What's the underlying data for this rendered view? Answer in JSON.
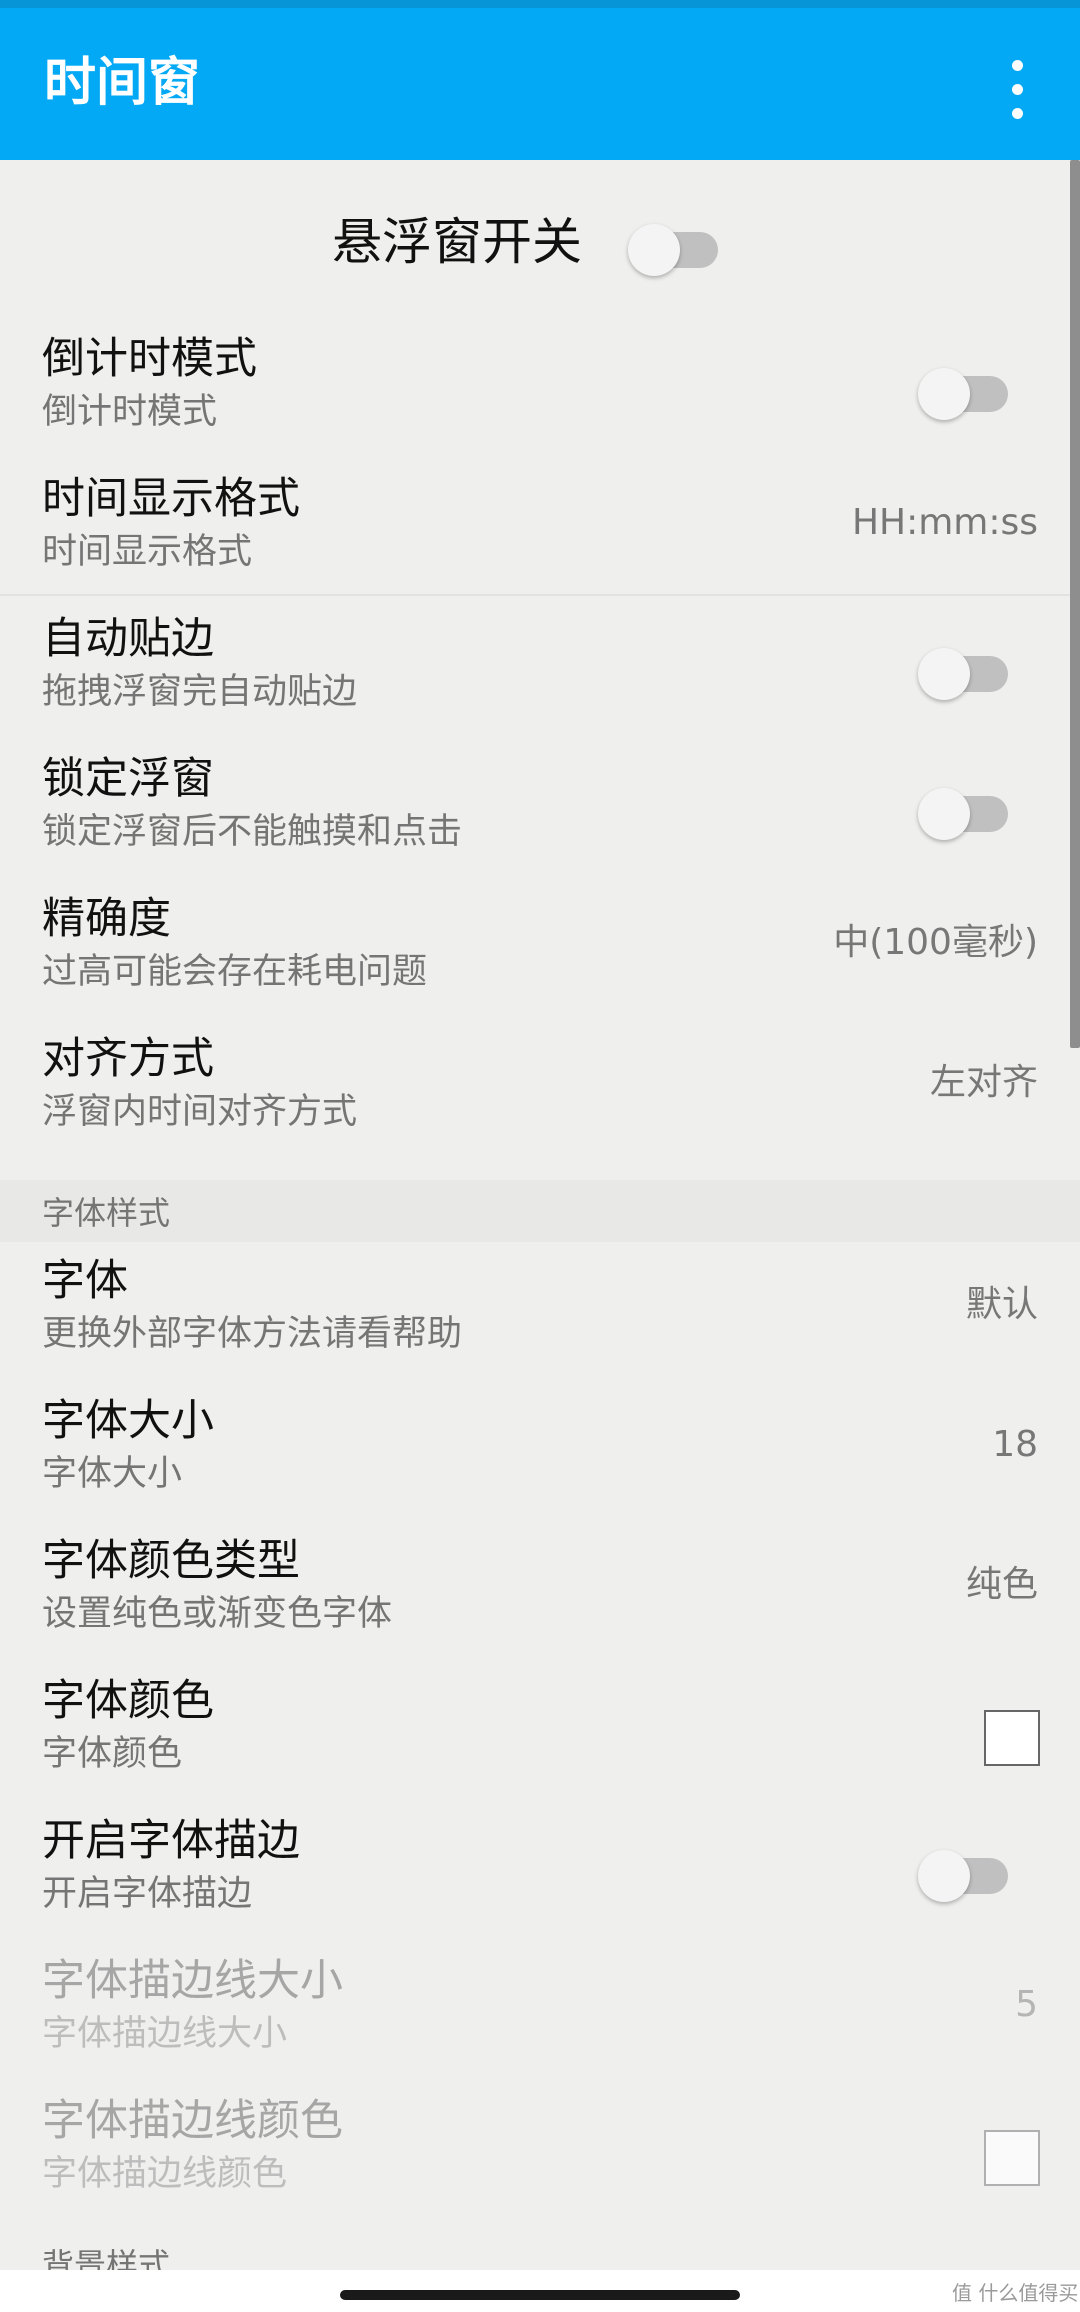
{
  "app": {
    "title": "时间窗"
  },
  "master_switch": {
    "label": "悬浮窗开关",
    "state": "off"
  },
  "prefs": [
    {
      "title": "倒计时模式",
      "summary": "倒计时模式",
      "widget": "switch",
      "state": "off"
    },
    {
      "title": "时间显示格式",
      "summary": "时间显示格式",
      "value": "HH:mm:ss"
    },
    {
      "title": "自动贴边",
      "summary": "拖拽浮窗完自动贴边",
      "widget": "switch",
      "state": "off"
    },
    {
      "title": "锁定浮窗",
      "summary": "锁定浮窗后不能触摸和点击",
      "widget": "switch",
      "state": "off"
    },
    {
      "title": "精确度",
      "summary": "过高可能会存在耗电问题",
      "value": "中(100毫秒)"
    },
    {
      "title": "对齐方式",
      "summary": "浮窗内时间对齐方式",
      "value": "左对齐"
    }
  ],
  "font_category": {
    "label": "字体样式"
  },
  "font_prefs": [
    {
      "title": "字体",
      "summary": "更换外部字体方法请看帮助",
      "value": "默认"
    },
    {
      "title": "字体大小",
      "summary": "字体大小",
      "value": "18"
    },
    {
      "title": "字体颜色类型",
      "summary": "设置纯色或渐变色字体",
      "value": "纯色"
    },
    {
      "title": "字体颜色",
      "summary": "字体颜色",
      "widget": "color",
      "color": "#ffffff"
    },
    {
      "title": "开启字体描边",
      "summary": "开启字体描边",
      "widget": "switch",
      "state": "off"
    },
    {
      "title": "字体描边线大小",
      "summary": "字体描边线大小",
      "value": "5",
      "enabled": false
    },
    {
      "title": "字体描边线颜色",
      "summary": "字体描边线颜色",
      "widget": "color",
      "color": "#fafafa",
      "enabled": false
    }
  ],
  "bg_category": {
    "label": "背景样式"
  },
  "watermark": "值 什么值得买",
  "colors": {
    "appbar": "#03a9f4",
    "statusbar": "#0895d8",
    "background": "#efefed"
  }
}
